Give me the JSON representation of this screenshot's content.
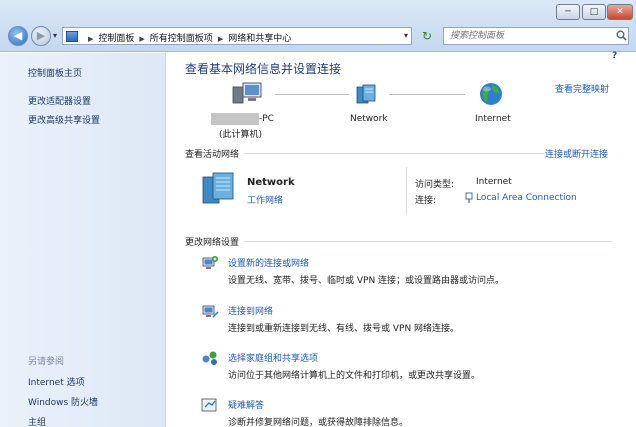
{
  "window": {
    "min_label": "─",
    "max_label": "□",
    "close_label": "✕"
  },
  "nav": {
    "back_glyph": "◀",
    "forward_glyph": "▶",
    "history_glyph": "▾"
  },
  "address": {
    "crumbs": [
      "控制面板",
      "所有控制面板项",
      "网络和共享中心"
    ],
    "separator": "▶",
    "dropdown_glyph": "▾",
    "refresh_glyph": "↻"
  },
  "search": {
    "placeholder": "搜索控制面板"
  },
  "help": {
    "label": "?"
  },
  "sidebar": {
    "items": [
      {
        "label": "控制面板主页"
      },
      {
        "label": "更改适配器设置"
      },
      {
        "label": "更改高级共享设置"
      }
    ],
    "see_also_title": "另请参阅",
    "see_also": [
      {
        "label": "Internet 选项"
      },
      {
        "label": "Windows 防火墙"
      },
      {
        "label": "主组"
      }
    ]
  },
  "main": {
    "title": "查看基本网络信息并设置连接",
    "view_full_map": "查看完整映射",
    "map": {
      "computer_name": "-PC",
      "computer_sub": "(此计算机)",
      "network": "Network",
      "internet": "Internet"
    },
    "active_title": "查看活动网络",
    "connect_disconnect": "连接或断开连接",
    "active": {
      "name": "Network",
      "type": "工作网络",
      "access_type_label": "访问类型:",
      "access_type_value": "Internet",
      "connections_label": "连接:",
      "connections_value": "Local Area Connection"
    },
    "change_title": "更改网络设置",
    "tasks": [
      {
        "title": "设置新的连接或网络",
        "desc": "设置无线、宽带、拨号、临时或 VPN 连接；或设置路由器或访问点。"
      },
      {
        "title": "连接到网络",
        "desc": "连接到或重新连接到无线、有线、拨号或 VPN 网络连接。"
      },
      {
        "title": "选择家庭组和共享选项",
        "desc": "访问位于其他网络计算机上的文件和打印机，或更改共享设置。"
      },
      {
        "title": "疑难解答",
        "desc": "诊断并修复网络问题，或获得故障排除信息。"
      }
    ]
  },
  "colors": {
    "link": "#1e5bb8",
    "title": "#1e3d7a",
    "sidebar_bg": "#dde8f6"
  }
}
